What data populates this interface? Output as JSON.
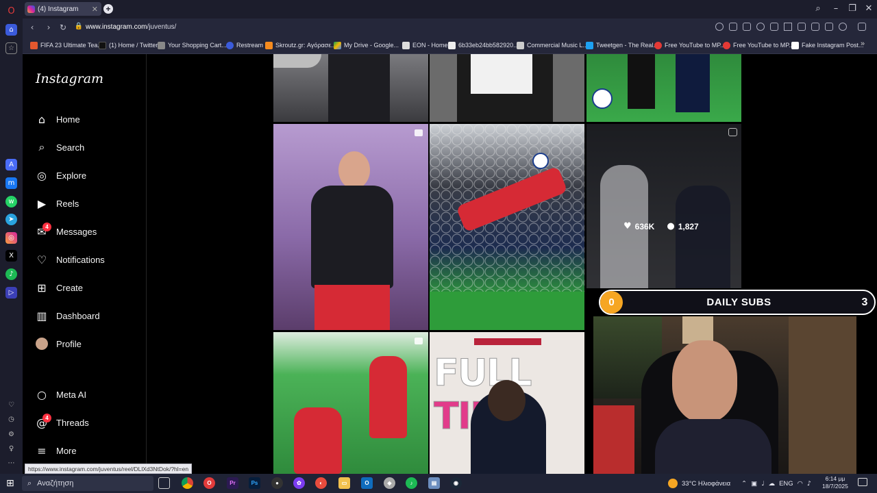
{
  "browser": {
    "tab_title": "(4) Instagram",
    "url_prefix": "www.instagram.com",
    "url_path": "/juventus/",
    "status_link": "https://www.instagram.com/juventus/reel/DLlXd3NtDok/?hl=en"
  },
  "bookmarks": [
    {
      "label": "FIFA 23 Ultimate Tea...",
      "icon": "fifa-icon",
      "color": "#e4572e"
    },
    {
      "label": "(1) Home / Twitter",
      "icon": "x-icon",
      "color": "#111111"
    },
    {
      "label": "Your Shopping Cart...",
      "icon": "cart-icon",
      "color": "#888888"
    },
    {
      "label": "Restream",
      "icon": "restream-icon",
      "color": "#3b5bdb"
    },
    {
      "label": "Skroutz.gr: Αγόρασε...",
      "icon": "skroutz-icon",
      "color": "#f68b1e"
    },
    {
      "label": "My Drive - Google...",
      "icon": "drive-icon",
      "color": "#f4b400"
    },
    {
      "label": "EON - Home",
      "icon": "eon-icon",
      "color": "#dddddd"
    },
    {
      "label": "6b33eb24bb582920...",
      "icon": "file-icon",
      "color": "#eeeeee"
    },
    {
      "label": "Commercial Music L...",
      "icon": "music-icon",
      "color": "#cccccc"
    },
    {
      "label": "Tweetgen - The Real...",
      "icon": "bird-icon",
      "color": "#1da1f2"
    },
    {
      "label": "Free YouTube to MP...",
      "icon": "youtube-icon",
      "color": "#e53935"
    },
    {
      "label": "Free YouTube to MP...",
      "icon": "youtube-icon",
      "color": "#e53935"
    },
    {
      "label": "Fake Instagram Post...",
      "icon": "fake-post-icon",
      "color": "#ffffff"
    }
  ],
  "sidebar": {
    "logo": "Instagram",
    "items": [
      {
        "label": "Home",
        "icon": "home-icon",
        "glyph": "⌂"
      },
      {
        "label": "Search",
        "icon": "search-icon",
        "glyph": "⌕"
      },
      {
        "label": "Explore",
        "icon": "compass-icon",
        "glyph": "◎"
      },
      {
        "label": "Reels",
        "icon": "reels-icon",
        "glyph": "▶"
      },
      {
        "label": "Messages",
        "icon": "messenger-icon",
        "glyph": "✉",
        "badge": "4"
      },
      {
        "label": "Notifications",
        "icon": "heart-icon",
        "glyph": "♡"
      },
      {
        "label": "Create",
        "icon": "plus-square-icon",
        "glyph": "⊞"
      },
      {
        "label": "Dashboard",
        "icon": "dashboard-icon",
        "glyph": "▥"
      },
      {
        "label": "Profile",
        "icon": "avatar",
        "glyph": "●"
      }
    ],
    "bottom_items": [
      {
        "label": "Meta AI",
        "icon": "meta-ai-icon",
        "glyph": "○"
      },
      {
        "label": "Threads",
        "icon": "threads-icon",
        "glyph": "@",
        "badge": "4"
      },
      {
        "label": "More",
        "icon": "menu-icon",
        "glyph": "≡"
      }
    ]
  },
  "post_hover": {
    "likes": "636K",
    "comments": "1,827"
  },
  "overlay": {
    "count": "0",
    "label": "DAILY SUBS",
    "goal": "3"
  },
  "taskbar": {
    "search_placeholder": "Αναζήτηση",
    "weather": "33°C  Ηλιοφάνεια",
    "language": "ENG",
    "time": "6:14 μμ",
    "date": "18/7/2025"
  },
  "colors": {
    "badge": "#ff3040",
    "overlay_circle": "#f6a623",
    "pitch_green": "#2e9c3a",
    "jersey_red": "#d62a35"
  }
}
